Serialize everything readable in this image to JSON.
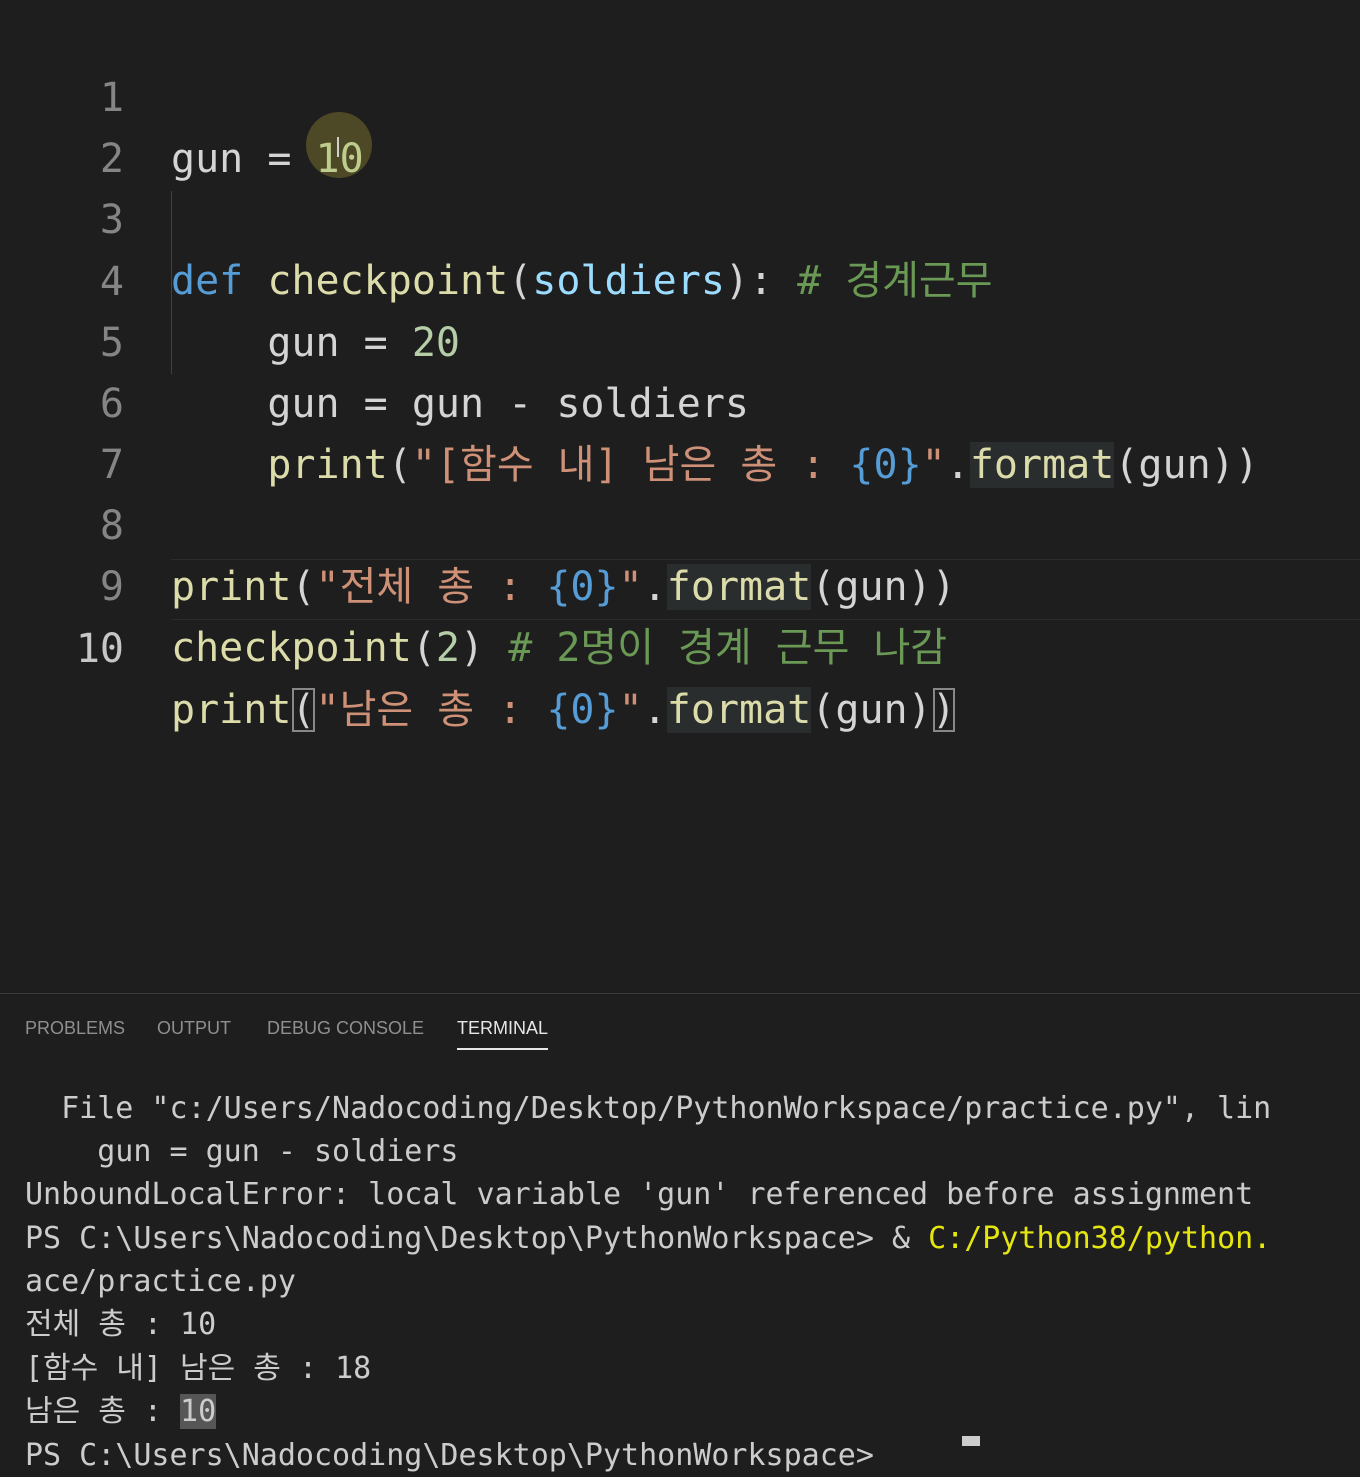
{
  "editor": {
    "lines": [
      {
        "num": "1",
        "text": "gun = 10"
      },
      {
        "num": "2",
        "text": ""
      },
      {
        "num": "3",
        "text": "def checkpoint(soldiers): # 경계근무"
      },
      {
        "num": "4",
        "text": "gun = 20"
      },
      {
        "num": "5",
        "text": "gun = gun - soldiers"
      },
      {
        "num": "6",
        "text": "print(\"[함수 내] 남은 총 : {0}\".format(gun))"
      },
      {
        "num": "7",
        "text": ""
      },
      {
        "num": "8",
        "text": "print(\"전체 총 : {0}\".format(gun))"
      },
      {
        "num": "9",
        "text": "checkpoint(2) # 2명이 경계 근무 나감"
      },
      {
        "num": "10",
        "text": "print(\"남은 총 : {0}\".format(gun))"
      }
    ],
    "tokens": {
      "gun": "gun",
      "eq": " = ",
      "n10": "10",
      "n20": "20",
      "n2": "2",
      "def": "def",
      "checkpoint": "checkpoint",
      "soldiers": "soldiers",
      "minus": " - ",
      "print": "print",
      "format": "format",
      "open_paren": "(",
      "close_paren": ")",
      "close_colon": "): ",
      "close_sp": ") ",
      "comment3": "# 경계근무",
      "comment9": "# 2명이 경계 근무 나감",
      "quote": "\"",
      "str6": "[함수 내] 남은 총 : ",
      "str8": "전체 총 : ",
      "str10": "남은 총 : ",
      "brace0": "{0}",
      "dot": ".",
      "args_gun": "(gun))",
      "args_gun_open": "(gun)",
      "indent": "    "
    }
  },
  "panel": {
    "tabs": [
      {
        "label": "PROBLEMS",
        "active": false
      },
      {
        "label": "OUTPUT",
        "active": false
      },
      {
        "label": "DEBUG CONSOLE",
        "active": false
      },
      {
        "label": "TERMINAL",
        "active": true
      }
    ]
  },
  "terminal": {
    "lines": [
      "  File \"c:/Users/Nadocoding/Desktop/PythonWorkspace/practice.py\", lin",
      "    gun = gun - soldiers",
      "UnboundLocalError: local variable 'gun' referenced before assignment",
      "ace/practice.py",
      "전체 총 : 10",
      "[함수 내] 남은 총 : 18"
    ],
    "ps_prompt": "PS C:\\Users\\Nadocoding\\Desktop\\PythonWorkspace> & ",
    "ps_path": "C:/Python38/python.",
    "last_prefix": "남은 총 : ",
    "last_selected": "10",
    "cut_line": "PS C:\\Users\\Nadocoding\\Desktop\\PythonWorkspace>"
  },
  "colors": {
    "background": "#1e1e1e",
    "keyword": "#569cd6",
    "function": "#dcdcaa",
    "string": "#ce9178",
    "number": "#b5cea8",
    "comment": "#6a9955",
    "param": "#9cdcfe",
    "terminal_path": "#e5e510"
  }
}
